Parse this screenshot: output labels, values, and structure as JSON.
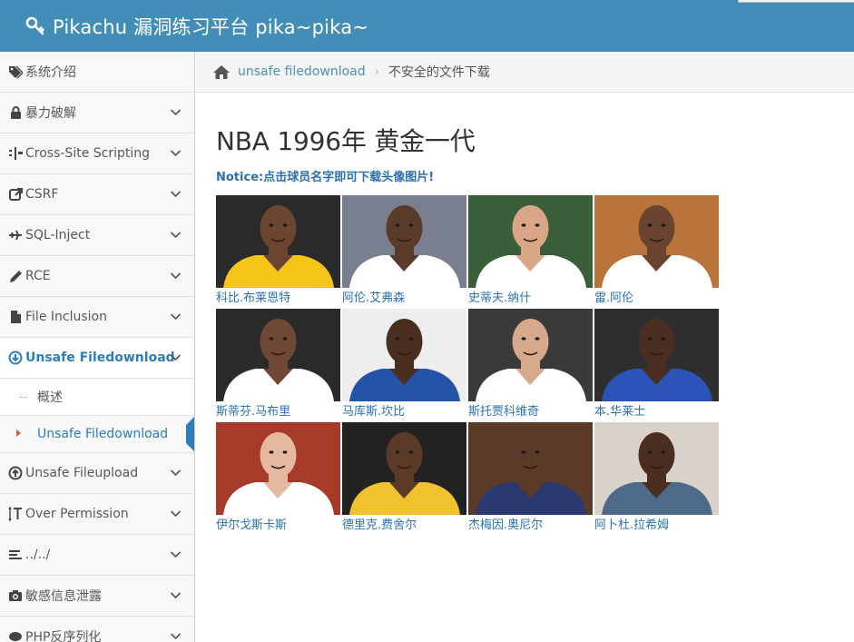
{
  "header": {
    "title": "Pikachu 漏洞练习平台 pika~pika~"
  },
  "sidebar": {
    "items": [
      {
        "label": "系统介绍",
        "icon": "tags-icon",
        "chevron": false
      },
      {
        "label": "暴力破解",
        "icon": "lock-icon",
        "chevron": true
      },
      {
        "label": "Cross-Site Scripting",
        "icon": "xss-icon",
        "chevron": true
      },
      {
        "label": "CSRF",
        "icon": "share-icon",
        "chevron": true
      },
      {
        "label": "SQL-Inject",
        "icon": "plane-icon",
        "chevron": true
      },
      {
        "label": "RCE",
        "icon": "pencil-icon",
        "chevron": true
      },
      {
        "label": "File Inclusion",
        "icon": "file-icon",
        "chevron": true
      },
      {
        "label": "Unsafe Filedownload",
        "icon": "download-icon",
        "chevron": true,
        "active": true
      },
      {
        "label": "Unsafe Fileupload",
        "icon": "upload-icon",
        "chevron": true
      },
      {
        "label": "Over Permission",
        "icon": "text-height-icon",
        "chevron": true
      },
      {
        "label": "../../",
        "icon": "align-left-icon",
        "chevron": true
      },
      {
        "label": "敏感信息泄露",
        "icon": "camera-icon",
        "chevron": true
      },
      {
        "label": "PHP反序列化",
        "icon": "php-icon",
        "chevron": true
      }
    ],
    "subitems": [
      {
        "label": "概述"
      },
      {
        "label": "Unsafe Filedownload",
        "selected": true
      }
    ]
  },
  "breadcrumb": {
    "link": "unsafe filedownload",
    "current": "不安全的文件下载"
  },
  "main": {
    "title": "NBA 1996年 黄金一代",
    "notice": "Notice:点击球员名字即可下载头像图片!",
    "players": [
      {
        "name": "科比.布莱恩特",
        "jersey": "#f5c518",
        "bg": "#2a2a2a",
        "skin": "#6b4530"
      },
      {
        "name": "阿伦.艾弗森",
        "jersey": "#ffffff",
        "bg": "#7a7f90",
        "skin": "#5a3a28"
      },
      {
        "name": "史蒂夫.纳什",
        "jersey": "#ffffff",
        "bg": "#3b5e3a",
        "skin": "#d9a688"
      },
      {
        "name": "雷.阿伦",
        "jersey": "#ffffff",
        "bg": "#b8743a",
        "skin": "#6a4430"
      },
      {
        "name": "斯蒂芬.马布里",
        "jersey": "#ffffff",
        "bg": "#2a2a2a",
        "skin": "#6e4834"
      },
      {
        "name": "马库斯.坎比",
        "jersey": "#2454a8",
        "bg": "#eeeeee",
        "skin": "#4a2e20"
      },
      {
        "name": "斯托贾科维奇",
        "jersey": "#ffffff",
        "bg": "#3a3a3a",
        "skin": "#d6a98c"
      },
      {
        "name": "本.华莱士",
        "jersey": "#2c54b8",
        "bg": "#2e2e2e",
        "skin": "#4a2e22"
      },
      {
        "name": "伊尔戈斯卡斯",
        "jersey": "#ffffff",
        "bg": "#a83a2a",
        "skin": "#e4b9a0"
      },
      {
        "name": "德里克.费舍尔",
        "jersey": "#f2c12e",
        "bg": "#222222",
        "skin": "#5c3a28"
      },
      {
        "name": "杰梅因.奥尼尔",
        "jersey": "#2a3a70",
        "bg": "#5a3a28",
        "skin": "#5a3a28"
      },
      {
        "name": "阿卜杜.拉希姆",
        "jersey": "#4d6a8a",
        "bg": "#d8d2c8",
        "skin": "#4a2e22"
      }
    ]
  },
  "colors": {
    "header": "#438eb9",
    "accent": "#2b7dbc",
    "link": "#2a72b5"
  }
}
